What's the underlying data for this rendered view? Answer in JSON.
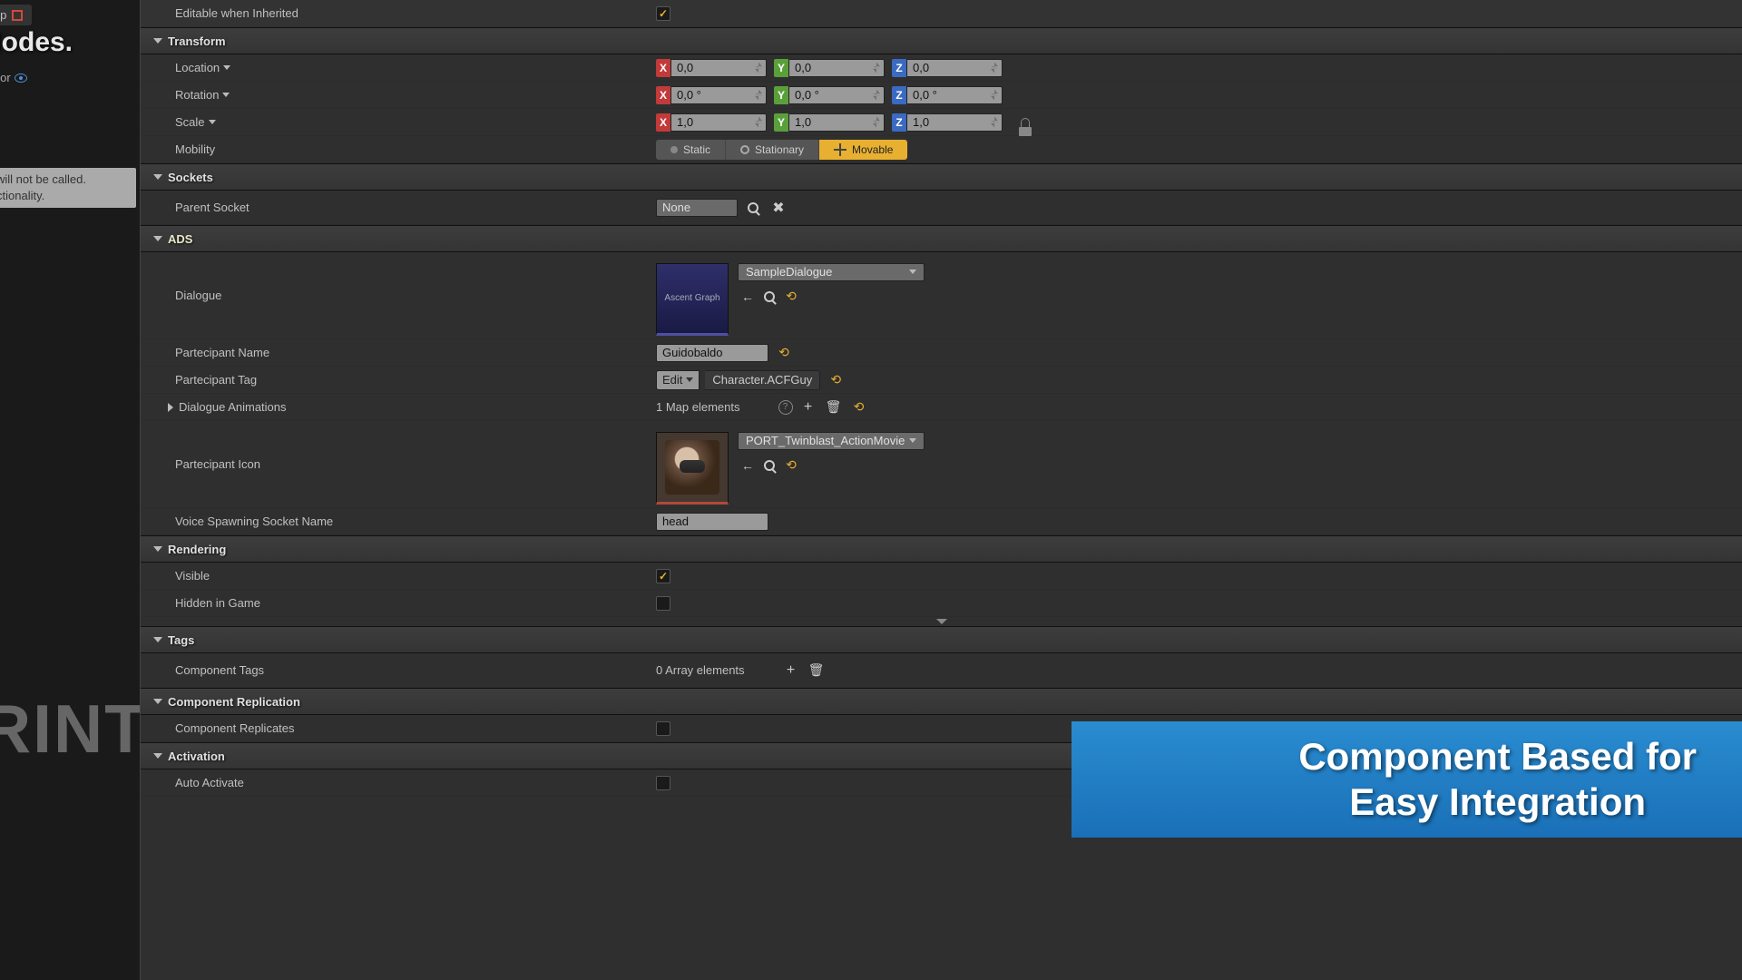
{
  "left": {
    "partial_tab": "lap",
    "title": "Nodes.",
    "ctor": "ctor",
    "note_line1": "will not be called.",
    "note_line2": "ctionality.",
    "big_text": "RINT"
  },
  "sections": {
    "editable_inherited": "Editable when Inherited",
    "transform": "Transform",
    "sockets": "Sockets",
    "ads": "ADS",
    "rendering": "Rendering",
    "tags": "Tags",
    "component_replication": "Component Replication",
    "activation": "Activation"
  },
  "transform": {
    "location": "Location",
    "rotation": "Rotation",
    "scale": "Scale",
    "mobility": "Mobility",
    "loc_x": "0,0",
    "loc_y": "0,0",
    "loc_z": "0,0",
    "rot_x": "0,0 °",
    "rot_y": "0,0 °",
    "rot_z": "0,0 °",
    "scl_x": "1,0",
    "scl_y": "1,0",
    "scl_z": "1,0",
    "mob_static": "Static",
    "mob_stationary": "Stationary",
    "mob_movable": "Movable"
  },
  "sockets": {
    "parent_socket": "Parent Socket",
    "parent_value": "None"
  },
  "ads": {
    "dialogue": "Dialogue",
    "dialogue_thumb": "Ascent Graph",
    "dialogue_asset": "SampleDialogue",
    "partecipant_name": "Partecipant Name",
    "partecipant_name_value": "Guidobaldo",
    "partecipant_tag": "Partecipant Tag",
    "edit_btn": "Edit",
    "tag_value": "Character.ACFGuy",
    "dialogue_animations": "Dialogue Animations",
    "map_elements": "1 Map elements",
    "partecipant_icon": "Partecipant Icon",
    "icon_asset": "PORT_Twinblast_ActionMovie",
    "voice_socket": "Voice Spawning Socket Name",
    "voice_value": "head"
  },
  "rendering": {
    "visible": "Visible",
    "hidden_in_game": "Hidden in Game"
  },
  "tags": {
    "component_tags": "Component Tags",
    "array_elements": "0 Array elements"
  },
  "replication": {
    "component_replicates": "Component Replicates"
  },
  "activation": {
    "auto_activate": "Auto Activate"
  },
  "banner": {
    "line1": "Component Based for",
    "line2": "Easy Integration"
  }
}
